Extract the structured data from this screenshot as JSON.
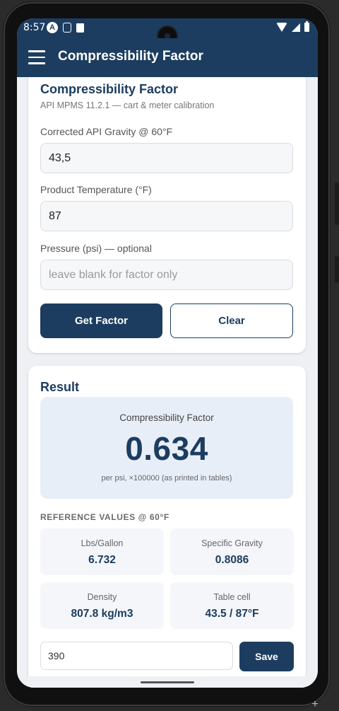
{
  "status": {
    "time": "8:57"
  },
  "appbar": {
    "title": "Compressibility Factor"
  },
  "form": {
    "title": "Compressibility Factor",
    "subtitle": "API MPMS 11.2.1 — cart & meter calibration",
    "api_label": "Corrected API Gravity @ 60°F",
    "api_value": "43,5",
    "temp_label": "Product Temperature (°F)",
    "temp_value": "87",
    "pressure_label": "Pressure (psi) — optional",
    "pressure_placeholder": "leave blank for factor only",
    "get_factor_label": "Get Factor",
    "clear_label": "Clear"
  },
  "result": {
    "title": "Result",
    "factor_label": "Compressibility Factor",
    "factor_value": "0.634",
    "factor_unit": "per psi, ×100000 (as printed in tables)",
    "reference_heading": "REFERENCE VALUES @ 60°F",
    "reference": [
      {
        "label": "Lbs/Gallon",
        "value": "6.732"
      },
      {
        "label": "Specific Gravity",
        "value": "0.8086"
      },
      {
        "label": "Density",
        "value": "807.8 kg/m3"
      },
      {
        "label": "Table cell",
        "value": "43.5 / 87°F"
      }
    ],
    "save_input_value": "390",
    "save_label": "Save"
  },
  "colors": {
    "primary": "#1c3d60",
    "background": "#eef0f4",
    "tile": "#f4f6f9",
    "result_bg": "#e8eef8"
  },
  "icons": [
    "hamburger-icon",
    "wifi-icon",
    "cell-signal-icon",
    "battery-icon"
  ]
}
